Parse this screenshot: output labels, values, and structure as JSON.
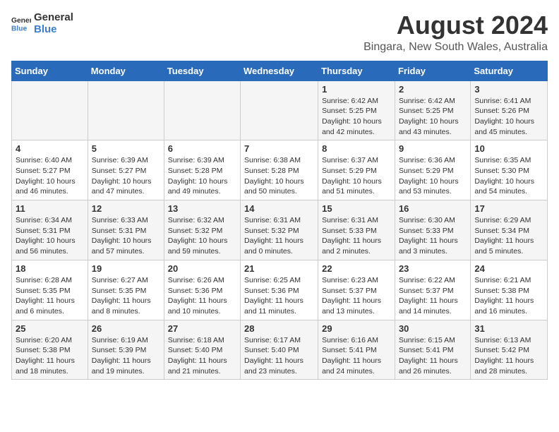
{
  "header": {
    "logo_line1": "General",
    "logo_line2": "Blue",
    "month_year": "August 2024",
    "location": "Bingara, New South Wales, Australia"
  },
  "days_of_week": [
    "Sunday",
    "Monday",
    "Tuesday",
    "Wednesday",
    "Thursday",
    "Friday",
    "Saturday"
  ],
  "weeks": [
    [
      {
        "day": "",
        "info": ""
      },
      {
        "day": "",
        "info": ""
      },
      {
        "day": "",
        "info": ""
      },
      {
        "day": "",
        "info": ""
      },
      {
        "day": "1",
        "info": "Sunrise: 6:42 AM\nSunset: 5:25 PM\nDaylight: 10 hours\nand 42 minutes."
      },
      {
        "day": "2",
        "info": "Sunrise: 6:42 AM\nSunset: 5:25 PM\nDaylight: 10 hours\nand 43 minutes."
      },
      {
        "day": "3",
        "info": "Sunrise: 6:41 AM\nSunset: 5:26 PM\nDaylight: 10 hours\nand 45 minutes."
      }
    ],
    [
      {
        "day": "4",
        "info": "Sunrise: 6:40 AM\nSunset: 5:27 PM\nDaylight: 10 hours\nand 46 minutes."
      },
      {
        "day": "5",
        "info": "Sunrise: 6:39 AM\nSunset: 5:27 PM\nDaylight: 10 hours\nand 47 minutes."
      },
      {
        "day": "6",
        "info": "Sunrise: 6:39 AM\nSunset: 5:28 PM\nDaylight: 10 hours\nand 49 minutes."
      },
      {
        "day": "7",
        "info": "Sunrise: 6:38 AM\nSunset: 5:28 PM\nDaylight: 10 hours\nand 50 minutes."
      },
      {
        "day": "8",
        "info": "Sunrise: 6:37 AM\nSunset: 5:29 PM\nDaylight: 10 hours\nand 51 minutes."
      },
      {
        "day": "9",
        "info": "Sunrise: 6:36 AM\nSunset: 5:29 PM\nDaylight: 10 hours\nand 53 minutes."
      },
      {
        "day": "10",
        "info": "Sunrise: 6:35 AM\nSunset: 5:30 PM\nDaylight: 10 hours\nand 54 minutes."
      }
    ],
    [
      {
        "day": "11",
        "info": "Sunrise: 6:34 AM\nSunset: 5:31 PM\nDaylight: 10 hours\nand 56 minutes."
      },
      {
        "day": "12",
        "info": "Sunrise: 6:33 AM\nSunset: 5:31 PM\nDaylight: 10 hours\nand 57 minutes."
      },
      {
        "day": "13",
        "info": "Sunrise: 6:32 AM\nSunset: 5:32 PM\nDaylight: 10 hours\nand 59 minutes."
      },
      {
        "day": "14",
        "info": "Sunrise: 6:31 AM\nSunset: 5:32 PM\nDaylight: 11 hours\nand 0 minutes."
      },
      {
        "day": "15",
        "info": "Sunrise: 6:31 AM\nSunset: 5:33 PM\nDaylight: 11 hours\nand 2 minutes."
      },
      {
        "day": "16",
        "info": "Sunrise: 6:30 AM\nSunset: 5:33 PM\nDaylight: 11 hours\nand 3 minutes."
      },
      {
        "day": "17",
        "info": "Sunrise: 6:29 AM\nSunset: 5:34 PM\nDaylight: 11 hours\nand 5 minutes."
      }
    ],
    [
      {
        "day": "18",
        "info": "Sunrise: 6:28 AM\nSunset: 5:35 PM\nDaylight: 11 hours\nand 6 minutes."
      },
      {
        "day": "19",
        "info": "Sunrise: 6:27 AM\nSunset: 5:35 PM\nDaylight: 11 hours\nand 8 minutes."
      },
      {
        "day": "20",
        "info": "Sunrise: 6:26 AM\nSunset: 5:36 PM\nDaylight: 11 hours\nand 10 minutes."
      },
      {
        "day": "21",
        "info": "Sunrise: 6:25 AM\nSunset: 5:36 PM\nDaylight: 11 hours\nand 11 minutes."
      },
      {
        "day": "22",
        "info": "Sunrise: 6:23 AM\nSunset: 5:37 PM\nDaylight: 11 hours\nand 13 minutes."
      },
      {
        "day": "23",
        "info": "Sunrise: 6:22 AM\nSunset: 5:37 PM\nDaylight: 11 hours\nand 14 minutes."
      },
      {
        "day": "24",
        "info": "Sunrise: 6:21 AM\nSunset: 5:38 PM\nDaylight: 11 hours\nand 16 minutes."
      }
    ],
    [
      {
        "day": "25",
        "info": "Sunrise: 6:20 AM\nSunset: 5:38 PM\nDaylight: 11 hours\nand 18 minutes."
      },
      {
        "day": "26",
        "info": "Sunrise: 6:19 AM\nSunset: 5:39 PM\nDaylight: 11 hours\nand 19 minutes."
      },
      {
        "day": "27",
        "info": "Sunrise: 6:18 AM\nSunset: 5:40 PM\nDaylight: 11 hours\nand 21 minutes."
      },
      {
        "day": "28",
        "info": "Sunrise: 6:17 AM\nSunset: 5:40 PM\nDaylight: 11 hours\nand 23 minutes."
      },
      {
        "day": "29",
        "info": "Sunrise: 6:16 AM\nSunset: 5:41 PM\nDaylight: 11 hours\nand 24 minutes."
      },
      {
        "day": "30",
        "info": "Sunrise: 6:15 AM\nSunset: 5:41 PM\nDaylight: 11 hours\nand 26 minutes."
      },
      {
        "day": "31",
        "info": "Sunrise: 6:13 AM\nSunset: 5:42 PM\nDaylight: 11 hours\nand 28 minutes."
      }
    ]
  ]
}
